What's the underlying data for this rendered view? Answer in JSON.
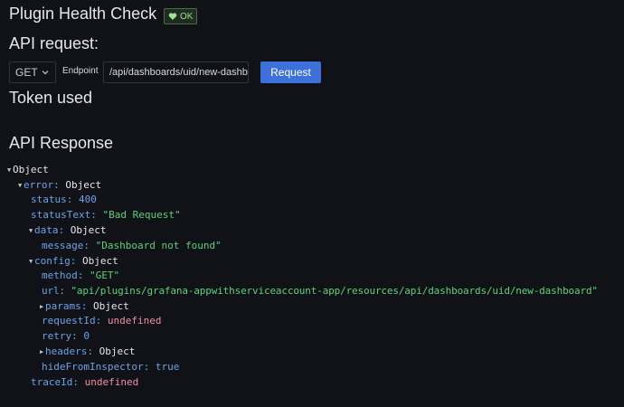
{
  "header": {
    "title": "Plugin Health Check",
    "status_badge": "OK",
    "colors": {
      "badge": "#73bf69"
    }
  },
  "request": {
    "section_title": "API request:",
    "method": "GET",
    "endpoint_label": "Endpoint",
    "endpoint_value": "/api/dashboards/uid/new-dashboard",
    "submit_label": "Request",
    "colors": {
      "button": "#3d71d9"
    }
  },
  "token_title": "Token used",
  "response_title": "API Response",
  "tree": {
    "root": "Object",
    "error_key": "error:",
    "error_type": "Object",
    "status_key": "status:",
    "status_val": "400",
    "statusText_key": "statusText:",
    "statusText_val": "\"Bad Request\"",
    "data_key": "data:",
    "data_type": "Object",
    "message_key": "message:",
    "message_val": "\"Dashboard not found\"",
    "config_key": "config:",
    "config_type": "Object",
    "method_key": "method:",
    "method_val": "\"GET\"",
    "url_key": "url:",
    "url_val": "\"api/plugins/grafana-appwithserviceaccount-app/resources/api/dashboards/uid/new-dashboard\"",
    "params_key": "params:",
    "params_type": "Object",
    "requestId_key": "requestId:",
    "requestId_val": "undefined",
    "retry_key": "retry:",
    "retry_val": "0",
    "headers_key": "headers:",
    "headers_type": "Object",
    "hideFromInspector_key": "hideFromInspector:",
    "hideFromInspector_val": "true",
    "traceId_key": "traceId:",
    "traceId_val": "undefined"
  }
}
